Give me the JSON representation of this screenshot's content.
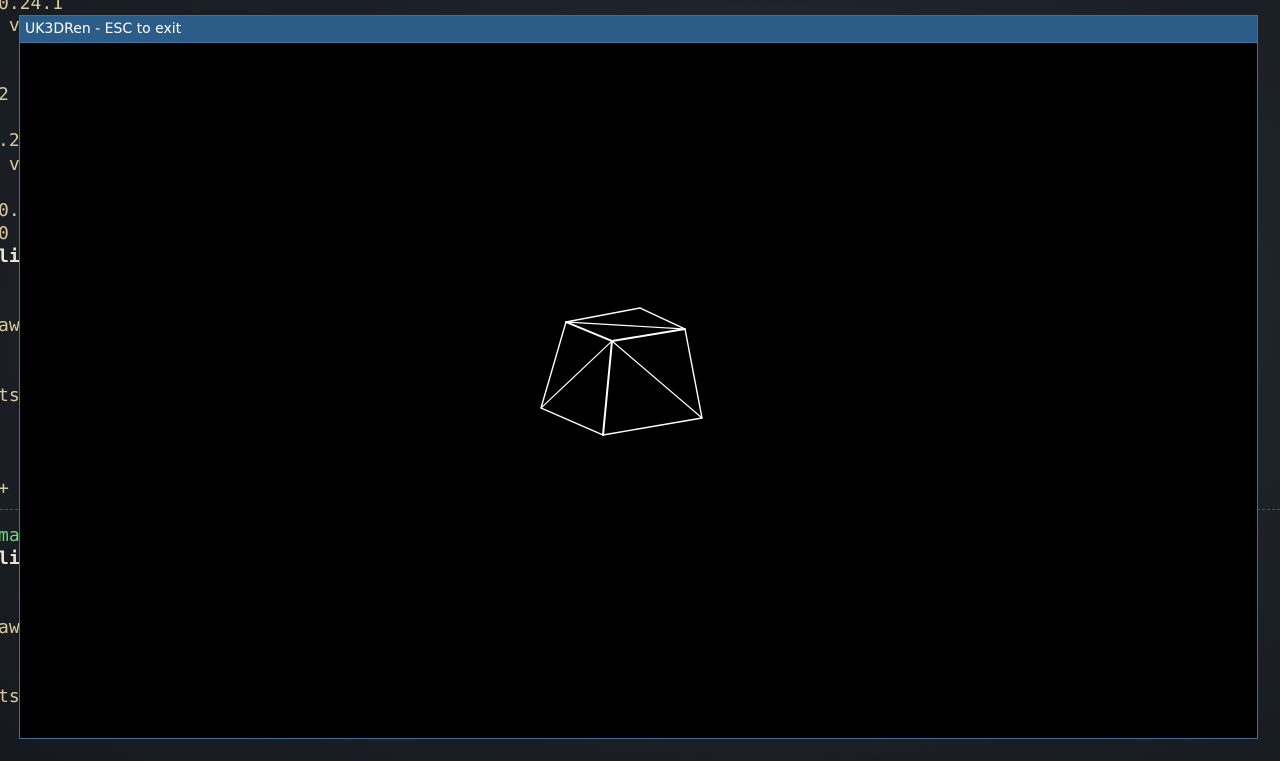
{
  "background_terminal": {
    "lines": [
      {
        "text": "0.24.1",
        "style": "normal"
      },
      {
        "text": " v",
        "style": "normal"
      },
      {
        "text": "2",
        "style": "normal"
      },
      {
        "text": ".2",
        "style": "normal"
      },
      {
        "text": " v",
        "style": "normal"
      },
      {
        "text": "0.",
        "style": "normal"
      },
      {
        "text": "0",
        "style": "normal"
      },
      {
        "text": "li",
        "style": "bold"
      },
      {
        "text": "aw",
        "style": "normal"
      },
      {
        "text": "ts",
        "style": "normal"
      },
      {
        "text": "+",
        "style": "normal"
      },
      {
        "text": "ma",
        "style": "green"
      },
      {
        "text": "li",
        "style": "bold"
      },
      {
        "text": "aw",
        "style": "normal"
      },
      {
        "text": "ts",
        "style": "normal"
      }
    ]
  },
  "window": {
    "title": "UK3DRen - ESC to exit"
  },
  "scene": {
    "object": "wireframe-frustum",
    "line_color": "#ffffff",
    "background_color": "#000000"
  }
}
